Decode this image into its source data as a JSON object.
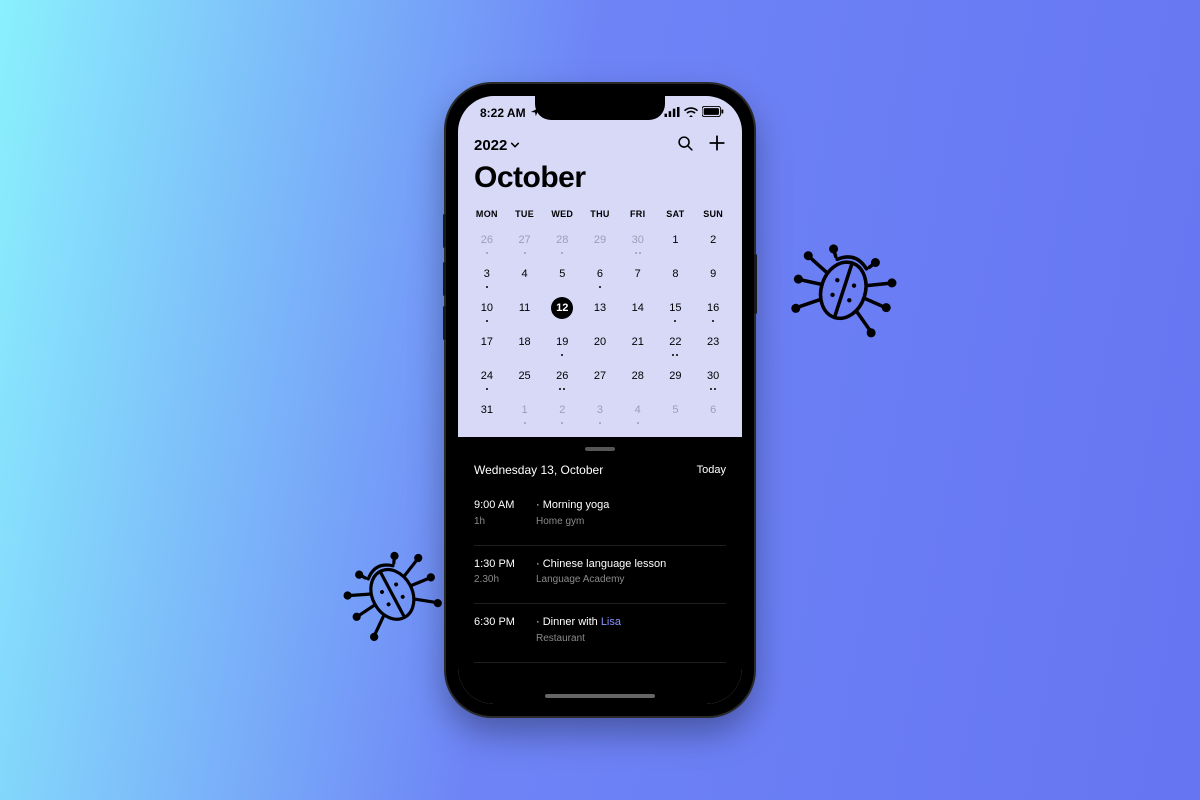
{
  "statusbar": {
    "time": "8:22 AM"
  },
  "header": {
    "year": "2022",
    "month": "October"
  },
  "days_of_week": [
    "MON",
    "TUE",
    "WED",
    "THU",
    "FRI",
    "SAT",
    "SUN"
  ],
  "weeks": [
    [
      {
        "n": "26",
        "muted": true,
        "dots": 1
      },
      {
        "n": "27",
        "muted": true,
        "dots": 1
      },
      {
        "n": "28",
        "muted": true,
        "dots": 1
      },
      {
        "n": "29",
        "muted": true,
        "dots": 0
      },
      {
        "n": "30",
        "muted": true,
        "dots": 2
      },
      {
        "n": "1",
        "dots": 0
      },
      {
        "n": "2",
        "dots": 0
      }
    ],
    [
      {
        "n": "3",
        "dots": 1
      },
      {
        "n": "4",
        "dots": 0
      },
      {
        "n": "5",
        "dots": 0
      },
      {
        "n": "6",
        "dots": 1
      },
      {
        "n": "7",
        "dots": 0
      },
      {
        "n": "8",
        "dots": 0
      },
      {
        "n": "9",
        "dots": 0
      }
    ],
    [
      {
        "n": "10",
        "dots": 1
      },
      {
        "n": "11",
        "dots": 0
      },
      {
        "n": "12",
        "dots": 0,
        "selected": true
      },
      {
        "n": "13",
        "dots": 0
      },
      {
        "n": "14",
        "dots": 0
      },
      {
        "n": "15",
        "dots": 1
      },
      {
        "n": "16",
        "dots": 1
      }
    ],
    [
      {
        "n": "17",
        "dots": 0
      },
      {
        "n": "18",
        "dots": 0
      },
      {
        "n": "19",
        "dots": 1
      },
      {
        "n": "20",
        "dots": 0
      },
      {
        "n": "21",
        "dots": 0
      },
      {
        "n": "22",
        "dots": 2
      },
      {
        "n": "23",
        "dots": 0
      }
    ],
    [
      {
        "n": "24",
        "dots": 1
      },
      {
        "n": "25",
        "dots": 0
      },
      {
        "n": "26",
        "dots": 2
      },
      {
        "n": "27",
        "dots": 0
      },
      {
        "n": "28",
        "dots": 0
      },
      {
        "n": "29",
        "dots": 0
      },
      {
        "n": "30",
        "dots": 2
      }
    ],
    [
      {
        "n": "31",
        "dots": 0
      },
      {
        "n": "1",
        "muted": true,
        "dots": 1
      },
      {
        "n": "2",
        "muted": true,
        "dots": 1
      },
      {
        "n": "3",
        "muted": true,
        "dots": 1
      },
      {
        "n": "4",
        "muted": true,
        "dots": 1
      },
      {
        "n": "5",
        "muted": true,
        "dots": 0
      },
      {
        "n": "6",
        "muted": true,
        "dots": 0
      }
    ]
  ],
  "panel": {
    "date_label": "Wednesday 13, October",
    "today_label": "Today",
    "events": [
      {
        "time": "9:00 AM",
        "duration": "1h",
        "title": "Morning yoga",
        "location": "Home gym",
        "mention": ""
      },
      {
        "time": "1:30 PM",
        "duration": "2.30h",
        "title": "Chinese language lesson",
        "location": "Language Academy",
        "mention": ""
      },
      {
        "time": "6:30 PM",
        "duration": "",
        "title": "Dinner with ",
        "location": "Restaurant",
        "mention": "Lisa"
      }
    ]
  }
}
